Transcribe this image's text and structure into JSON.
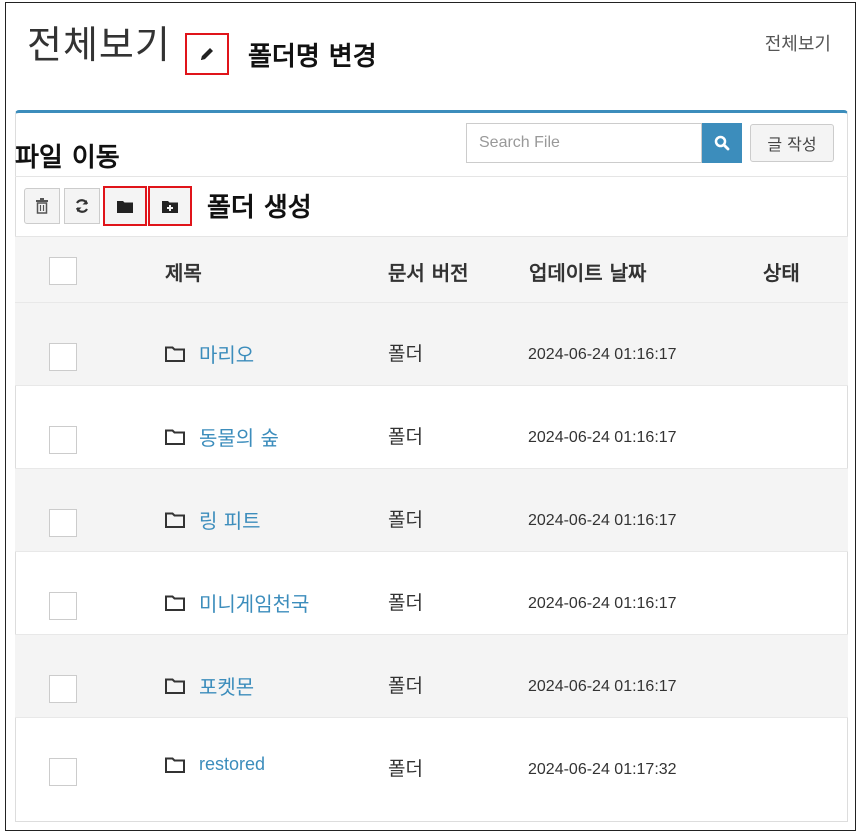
{
  "page": {
    "title": "전체보기",
    "breadcrumb": "전체보기"
  },
  "annotations": {
    "rename_folder": "폴더명 변경",
    "move_file": "파일 이동",
    "create_folder": "폴더 생성"
  },
  "search": {
    "placeholder": "Search File"
  },
  "buttons": {
    "write": "글 작성"
  },
  "toolbar": {
    "icons": [
      "trash-icon",
      "refresh-icon",
      "folder-icon",
      "folder-plus-icon"
    ]
  },
  "table": {
    "headers": [
      "제목",
      "문서 버전",
      "업데이트 날짜",
      "상태"
    ],
    "rows": [
      {
        "name": "마리오",
        "version": "폴더",
        "updated": "2024-06-24 01:16:17"
      },
      {
        "name": "동물의 숲",
        "version": "폴더",
        "updated": "2024-06-24 01:16:17"
      },
      {
        "name": "링 피트",
        "version": "폴더",
        "updated": "2024-06-24 01:16:17"
      },
      {
        "name": "미니게임천국",
        "version": "폴더",
        "updated": "2024-06-24 01:16:17"
      },
      {
        "name": "포켓몬",
        "version": "폴더",
        "updated": "2024-06-24 01:16:17"
      },
      {
        "name": "restored",
        "version": "폴더",
        "updated": "2024-06-24 01:17:32"
      }
    ]
  },
  "colors": {
    "accent": "#3c8dbc",
    "highlight": "#e0141a"
  }
}
